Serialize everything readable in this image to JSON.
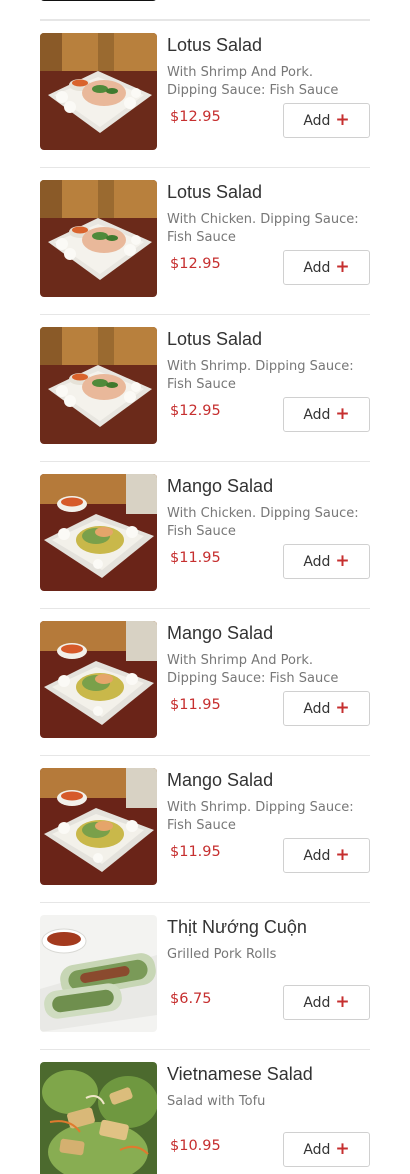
{
  "menu": {
    "items": [
      {
        "name": "Lotus Salad",
        "description": "With Shrimp And Pork. Dipping Sauce: Fish Sauce",
        "price": "$12.95",
        "add_label": "Add",
        "image": "lotus-salad-photo"
      },
      {
        "name": "Lotus Salad",
        "description": "With Chicken. Dipping Sauce: Fish Sauce",
        "price": "$12.95",
        "add_label": "Add",
        "image": "lotus-salad-photo"
      },
      {
        "name": "Lotus Salad",
        "description": "With Shrimp. Dipping Sauce: Fish Sauce",
        "price": "$12.95",
        "add_label": "Add",
        "image": "lotus-salad-photo"
      },
      {
        "name": "Mango Salad",
        "description": "With Chicken. Dipping Sauce: Fish Sauce",
        "price": "$11.95",
        "add_label": "Add",
        "image": "mango-salad-photo"
      },
      {
        "name": "Mango Salad",
        "description": "With Shrimp And Pork. Dipping Sauce: Fish Sauce",
        "price": "$11.95",
        "add_label": "Add",
        "image": "mango-salad-photo"
      },
      {
        "name": "Mango Salad",
        "description": "With Shrimp. Dipping Sauce: Fish Sauce",
        "price": "$11.95",
        "add_label": "Add",
        "image": "mango-salad-photo"
      },
      {
        "name": "Thịt Nướng Cuộn",
        "description": "Grilled Pork Rolls",
        "price": "$6.75",
        "add_label": "Add",
        "image": "grilled-pork-rolls-photo"
      },
      {
        "name": "Vietnamese Salad",
        "description": "Salad with Tofu",
        "price": "$10.95",
        "add_label": "Add",
        "image": "tofu-salad-photo"
      }
    ]
  },
  "colors": {
    "price": "#c62f2f",
    "plus": "#c62f2f",
    "divider": "#e6e6e6"
  },
  "icons": {
    "add": "plus-icon"
  }
}
